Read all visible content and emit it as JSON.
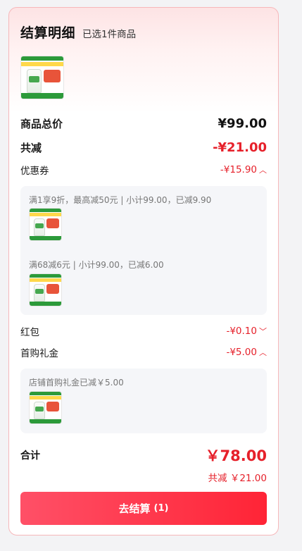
{
  "header": {
    "title": "结算明细",
    "subtitle": "已选1件商品"
  },
  "rows": {
    "total_price_label": "商品总价",
    "total_price_value": "¥99.00",
    "total_discount_label": "共减",
    "total_discount_value": "-¥21.00",
    "coupon_label": "优惠券",
    "coupon_value": "-¥15.90",
    "red_packet_label": "红包",
    "red_packet_value": "-¥0.10",
    "first_gift_label": "首购礼金",
    "first_gift_value": "-¥5.00"
  },
  "coupon_panel": {
    "line1": "满1享9折，最高减50元 | 小计99.00，已减9.90",
    "line2": "满68减6元 | 小计99.00，已减6.00"
  },
  "gift_panel": {
    "line1": "店铺首购礼金已减￥5.00"
  },
  "summary": {
    "label": "合计",
    "value": "￥78.00",
    "discount": "共减 ￥21.00"
  },
  "checkout": {
    "label": "去结算",
    "count": "(1)"
  },
  "colors": {
    "accent_red": "#e6202a",
    "button_gradient_start": "#ff5067",
    "button_gradient_end": "#ff2436"
  },
  "icons": {
    "expand": "chevron-up-icon",
    "collapse": "chevron-down-icon"
  }
}
